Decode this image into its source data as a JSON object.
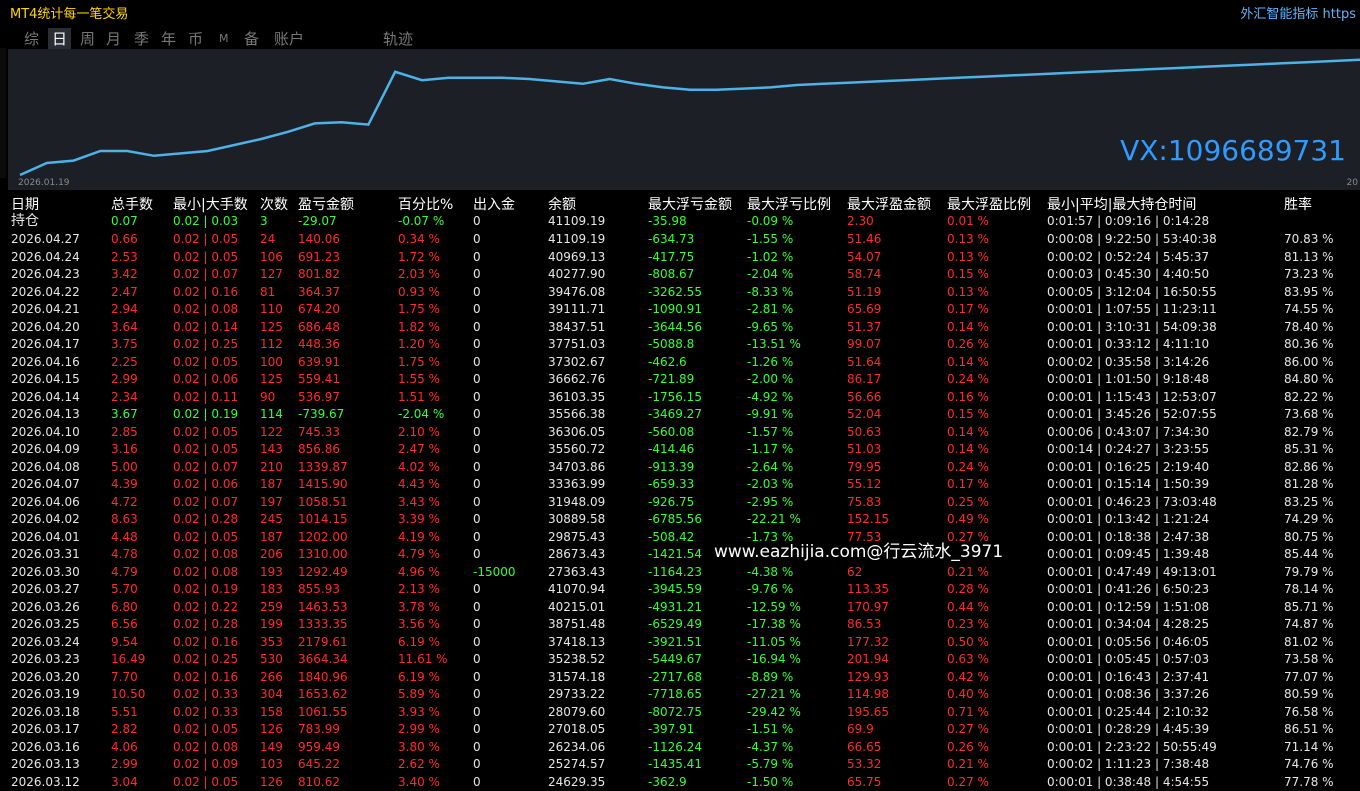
{
  "window": {
    "title": "MT4统计每一笔交易",
    "brand": "外汇智能指标 https"
  },
  "tabs": [
    {
      "label": "综",
      "active": false
    },
    {
      "label": "日",
      "active": true
    },
    {
      "label": "周",
      "active": false
    },
    {
      "label": "月",
      "active": false
    },
    {
      "label": "季",
      "active": false
    },
    {
      "label": "年",
      "active": false
    },
    {
      "label": "币",
      "active": false
    },
    {
      "label": "M",
      "active": false
    },
    {
      "label": "备",
      "active": false
    },
    {
      "label": "账户",
      "active": false
    },
    {
      "label": "轨迹",
      "active": false
    }
  ],
  "chart_data": {
    "type": "line",
    "x_start_label": "2026.01.19",
    "x_end_label": "20",
    "values": [
      0,
      0.1,
      0.12,
      0.2,
      0.2,
      0.16,
      0.18,
      0.2,
      0.25,
      0.3,
      0.36,
      0.43,
      0.44,
      0.42,
      0.86,
      0.79,
      0.81,
      0.81,
      0.81,
      0.8,
      0.78,
      0.76,
      0.8,
      0.76,
      0.73,
      0.71,
      0.71,
      0.72,
      0.73,
      0.75,
      0.76,
      0.77,
      0.78,
      0.79,
      0.8,
      0.81,
      0.82,
      0.83,
      0.84,
      0.85,
      0.86,
      0.87,
      0.88,
      0.89,
      0.9,
      0.91,
      0.92,
      0.93,
      0.94,
      0.95,
      0.96
    ],
    "color": "#4cb2e8"
  },
  "overlay": {
    "vx": "VX:1096689731",
    "watermark": "www.eazhijia.com@行云流水_3971"
  },
  "table": {
    "headers": [
      "日期",
      "总手数",
      "最小|大手数",
      "次数",
      "盈亏金额",
      "百分比%",
      "出入金",
      "余额",
      "最大浮亏金额",
      "最大浮亏比例",
      "最大浮盈金额",
      "最大浮盈比例",
      "最小|平均|最大持仓时间",
      "胜率"
    ],
    "holding": {
      "label": "持仓",
      "lots": "0.07",
      "minmax": "0.02 | 0.03",
      "count": "3",
      "pnl": "-29.07",
      "pct": "-0.07 %",
      "io": "0",
      "balance": "41109.19",
      "max_loss": "-35.98",
      "max_loss_pct": "-0.09 %",
      "max_profit": "2.30",
      "max_profit_pct": "0.01 %",
      "time": "0:01:57 | 0:09:16 | 0:14:28",
      "winrate": ""
    },
    "rows": [
      {
        "date": "2026.04.27",
        "lots": "0.66",
        "minmax": "0.02 | 0.05",
        "count": "24",
        "pnl": "140.06",
        "pct": "0.34 %",
        "io": "0",
        "balance": "41109.19",
        "max_loss": "-634.73",
        "max_loss_pct": "-1.55 %",
        "max_profit": "51.46",
        "max_profit_pct": "0.13 %",
        "time": "0:00:08 | 9:22:50 | 53:40:38",
        "winrate": "70.83 %",
        "pos": true
      },
      {
        "date": "2026.04.24",
        "lots": "2.53",
        "minmax": "0.02 | 0.05",
        "count": "106",
        "pnl": "691.23",
        "pct": "1.72 %",
        "io": "0",
        "balance": "40969.13",
        "max_loss": "-417.75",
        "max_loss_pct": "-1.02 %",
        "max_profit": "54.07",
        "max_profit_pct": "0.13 %",
        "time": "0:00:02 | 0:52:24 | 5:45:37",
        "winrate": "81.13 %",
        "pos": true
      },
      {
        "date": "2026.04.23",
        "lots": "3.42",
        "minmax": "0.02 | 0.07",
        "count": "127",
        "pnl": "801.82",
        "pct": "2.03 %",
        "io": "0",
        "balance": "40277.90",
        "max_loss": "-808.67",
        "max_loss_pct": "-2.04 %",
        "max_profit": "58.74",
        "max_profit_pct": "0.15 %",
        "time": "0:00:03 | 0:45:30 | 4:40:50",
        "winrate": "73.23 %",
        "pos": true
      },
      {
        "date": "2026.04.22",
        "lots": "2.47",
        "minmax": "0.02 | 0.16",
        "count": "81",
        "pnl": "364.37",
        "pct": "0.93 %",
        "io": "0",
        "balance": "39476.08",
        "max_loss": "-3262.55",
        "max_loss_pct": "-8.33 %",
        "max_profit": "51.19",
        "max_profit_pct": "0.13 %",
        "time": "0:00:05 | 3:12:04 | 16:50:55",
        "winrate": "83.95 %",
        "pos": true
      },
      {
        "date": "2026.04.21",
        "lots": "2.94",
        "minmax": "0.02 | 0.08",
        "count": "110",
        "pnl": "674.20",
        "pct": "1.75 %",
        "io": "0",
        "balance": "39111.71",
        "max_loss": "-1090.91",
        "max_loss_pct": "-2.81 %",
        "max_profit": "65.69",
        "max_profit_pct": "0.17 %",
        "time": "0:00:01 | 1:07:55 | 11:23:11",
        "winrate": "74.55 %",
        "pos": true
      },
      {
        "date": "2026.04.20",
        "lots": "3.64",
        "minmax": "0.02 | 0.14",
        "count": "125",
        "pnl": "686.48",
        "pct": "1.82 %",
        "io": "0",
        "balance": "38437.51",
        "max_loss": "-3644.56",
        "max_loss_pct": "-9.65 %",
        "max_profit": "51.37",
        "max_profit_pct": "0.14 %",
        "time": "0:00:01 | 3:10:31 | 54:09:38",
        "winrate": "78.40 %",
        "pos": true
      },
      {
        "date": "2026.04.17",
        "lots": "3.75",
        "minmax": "0.02 | 0.25",
        "count": "112",
        "pnl": "448.36",
        "pct": "1.20 %",
        "io": "0",
        "balance": "37751.03",
        "max_loss": "-5088.8",
        "max_loss_pct": "-13.51 %",
        "max_profit": "99.07",
        "max_profit_pct": "0.26 %",
        "time": "0:00:01 | 0:33:12 | 4:11:10",
        "winrate": "80.36 %",
        "pos": true
      },
      {
        "date": "2026.04.16",
        "lots": "2.25",
        "minmax": "0.02 | 0.05",
        "count": "100",
        "pnl": "639.91",
        "pct": "1.75 %",
        "io": "0",
        "balance": "37302.67",
        "max_loss": "-462.6",
        "max_loss_pct": "-1.26 %",
        "max_profit": "51.64",
        "max_profit_pct": "0.14 %",
        "time": "0:00:02 | 0:35:58 | 3:14:26",
        "winrate": "86.00 %",
        "pos": true
      },
      {
        "date": "2026.04.15",
        "lots": "2.99",
        "minmax": "0.02 | 0.06",
        "count": "125",
        "pnl": "559.41",
        "pct": "1.55 %",
        "io": "0",
        "balance": "36662.76",
        "max_loss": "-721.89",
        "max_loss_pct": "-2.00 %",
        "max_profit": "86.17",
        "max_profit_pct": "0.24 %",
        "time": "0:00:01 | 1:01:50 | 9:18:48",
        "winrate": "84.80 %",
        "pos": true
      },
      {
        "date": "2026.04.14",
        "lots": "2.34",
        "minmax": "0.02 | 0.11",
        "count": "90",
        "pnl": "536.97",
        "pct": "1.51 %",
        "io": "0",
        "balance": "36103.35",
        "max_loss": "-1756.15",
        "max_loss_pct": "-4.92 %",
        "max_profit": "56.66",
        "max_profit_pct": "0.16 %",
        "time": "0:00:01 | 1:15:43 | 12:53:07",
        "winrate": "82.22 %",
        "pos": true
      },
      {
        "date": "2026.04.13",
        "lots": "3.67",
        "minmax": "0.02 | 0.19",
        "count": "114",
        "pnl": "-739.67",
        "pct": "-2.04 %",
        "io": "0",
        "balance": "35566.38",
        "max_loss": "-3469.27",
        "max_loss_pct": "-9.91 %",
        "max_profit": "52.04",
        "max_profit_pct": "0.15 %",
        "time": "0:00:01 | 3:45:26 | 52:07:55",
        "winrate": "73.68 %",
        "pos": false
      },
      {
        "date": "2026.04.10",
        "lots": "2.85",
        "minmax": "0.02 | 0.05",
        "count": "122",
        "pnl": "745.33",
        "pct": "2.10 %",
        "io": "0",
        "balance": "36306.05",
        "max_loss": "-560.08",
        "max_loss_pct": "-1.57 %",
        "max_profit": "50.63",
        "max_profit_pct": "0.14 %",
        "time": "0:00:06 | 0:43:07 | 7:34:30",
        "winrate": "82.79 %",
        "pos": true
      },
      {
        "date": "2026.04.09",
        "lots": "3.16",
        "minmax": "0.02 | 0.05",
        "count": "143",
        "pnl": "856.86",
        "pct": "2.47 %",
        "io": "0",
        "balance": "35560.72",
        "max_loss": "-414.46",
        "max_loss_pct": "-1.17 %",
        "max_profit": "51.03",
        "max_profit_pct": "0.14 %",
        "time": "0:00:14 | 0:24:27 | 3:23:55",
        "winrate": "85.31 %",
        "pos": true
      },
      {
        "date": "2026.04.08",
        "lots": "5.00",
        "minmax": "0.02 | 0.07",
        "count": "210",
        "pnl": "1339.87",
        "pct": "4.02 %",
        "io": "0",
        "balance": "34703.86",
        "max_loss": "-913.39",
        "max_loss_pct": "-2.64 %",
        "max_profit": "79.95",
        "max_profit_pct": "0.24 %",
        "time": "0:00:01 | 0:16:25 | 2:19:40",
        "winrate": "82.86 %",
        "pos": true
      },
      {
        "date": "2026.04.07",
        "lots": "4.39",
        "minmax": "0.02 | 0.06",
        "count": "187",
        "pnl": "1415.90",
        "pct": "4.43 %",
        "io": "0",
        "balance": "33363.99",
        "max_loss": "-659.33",
        "max_loss_pct": "-2.03 %",
        "max_profit": "55.12",
        "max_profit_pct": "0.17 %",
        "time": "0:00:01 | 0:15:14 | 1:50:39",
        "winrate": "81.28 %",
        "pos": true
      },
      {
        "date": "2026.04.06",
        "lots": "4.72",
        "minmax": "0.02 | 0.07",
        "count": "197",
        "pnl": "1058.51",
        "pct": "3.43 %",
        "io": "0",
        "balance": "31948.09",
        "max_loss": "-926.75",
        "max_loss_pct": "-2.95 %",
        "max_profit": "75.83",
        "max_profit_pct": "0.25 %",
        "time": "0:00:01 | 0:46:23 | 73:03:48",
        "winrate": "83.25 %",
        "pos": true
      },
      {
        "date": "2026.04.02",
        "lots": "8.63",
        "minmax": "0.02 | 0.28",
        "count": "245",
        "pnl": "1014.15",
        "pct": "3.39 %",
        "io": "0",
        "balance": "30889.58",
        "max_loss": "-6785.56",
        "max_loss_pct": "-22.21 %",
        "max_profit": "152.15",
        "max_profit_pct": "0.49 %",
        "time": "0:00:01 | 0:13:42 | 1:21:24",
        "winrate": "74.29 %",
        "pos": true
      },
      {
        "date": "2026.04.01",
        "lots": "4.48",
        "minmax": "0.02 | 0.05",
        "count": "187",
        "pnl": "1202.00",
        "pct": "4.19 %",
        "io": "0",
        "balance": "29875.43",
        "max_loss": "-508.42",
        "max_loss_pct": "-1.73 %",
        "max_profit": "77.53",
        "max_profit_pct": "0.27 %",
        "time": "0:00:01 | 0:18:38 | 2:47:38",
        "winrate": "80.75 %",
        "pos": true
      },
      {
        "date": "2026.03.31",
        "lots": "4.78",
        "minmax": "0.02 | 0.08",
        "count": "206",
        "pnl": "1310.00",
        "pct": "4.79 %",
        "io": "0",
        "balance": "28673.43",
        "max_loss": "-1421.54",
        "max_loss_pct": "",
        "max_profit": "",
        "max_profit_pct": "",
        "time": "0:00:01 | 0:09:45 | 1:39:48",
        "winrate": "85.44 %",
        "pos": true
      },
      {
        "date": "2026.03.30",
        "lots": "4.79",
        "minmax": "0.02 | 0.08",
        "count": "193",
        "pnl": "1292.49",
        "pct": "4.96 %",
        "io": "-15000",
        "balance": "27363.43",
        "max_loss": "-1164.23",
        "max_loss_pct": "-4.38 %",
        "max_profit": "62",
        "max_profit_pct": "0.21 %",
        "time": "0:00:01 | 0:47:49 | 49:13:01",
        "winrate": "79.79 %",
        "pos": true
      },
      {
        "date": "2026.03.27",
        "lots": "5.70",
        "minmax": "0.02 | 0.19",
        "count": "183",
        "pnl": "855.93",
        "pct": "2.13 %",
        "io": "0",
        "balance": "41070.94",
        "max_loss": "-3945.59",
        "max_loss_pct": "-9.76 %",
        "max_profit": "113.35",
        "max_profit_pct": "0.28 %",
        "time": "0:00:01 | 0:41:26 | 6:50:23",
        "winrate": "78.14 %",
        "pos": true
      },
      {
        "date": "2026.03.26",
        "lots": "6.80",
        "minmax": "0.02 | 0.22",
        "count": "259",
        "pnl": "1463.53",
        "pct": "3.78 %",
        "io": "0",
        "balance": "40215.01",
        "max_loss": "-4931.21",
        "max_loss_pct": "-12.59 %",
        "max_profit": "170.97",
        "max_profit_pct": "0.44 %",
        "time": "0:00:01 | 0:12:59 | 1:51:08",
        "winrate": "85.71 %",
        "pos": true
      },
      {
        "date": "2026.03.25",
        "lots": "6.56",
        "minmax": "0.02 | 0.28",
        "count": "199",
        "pnl": "1333.35",
        "pct": "3.56 %",
        "io": "0",
        "balance": "38751.48",
        "max_loss": "-6529.49",
        "max_loss_pct": "-17.38 %",
        "max_profit": "86.53",
        "max_profit_pct": "0.23 %",
        "time": "0:00:01 | 0:34:04 | 4:28:25",
        "winrate": "74.87 %",
        "pos": true
      },
      {
        "date": "2026.03.24",
        "lots": "9.54",
        "minmax": "0.02 | 0.16",
        "count": "353",
        "pnl": "2179.61",
        "pct": "6.19 %",
        "io": "0",
        "balance": "37418.13",
        "max_loss": "-3921.51",
        "max_loss_pct": "-11.05 %",
        "max_profit": "177.32",
        "max_profit_pct": "0.50 %",
        "time": "0:00:01 | 0:05:56 | 0:46:05",
        "winrate": "81.02 %",
        "pos": true
      },
      {
        "date": "2026.03.23",
        "lots": "16.49",
        "minmax": "0.02 | 0.25",
        "count": "530",
        "pnl": "3664.34",
        "pct": "11.61 %",
        "io": "0",
        "balance": "35238.52",
        "max_loss": "-5449.67",
        "max_loss_pct": "-16.94 %",
        "max_profit": "201.94",
        "max_profit_pct": "0.63 %",
        "time": "0:00:01 | 0:05:45 | 0:57:03",
        "winrate": "73.58 %",
        "pos": true
      },
      {
        "date": "2026.03.20",
        "lots": "7.70",
        "minmax": "0.02 | 0.16",
        "count": "266",
        "pnl": "1840.96",
        "pct": "6.19 %",
        "io": "0",
        "balance": "31574.18",
        "max_loss": "-2717.68",
        "max_loss_pct": "-8.89 %",
        "max_profit": "129.93",
        "max_profit_pct": "0.42 %",
        "time": "0:00:01 | 0:16:43 | 2:37:41",
        "winrate": "77.07 %",
        "pos": true
      },
      {
        "date": "2026.03.19",
        "lots": "10.50",
        "minmax": "0.02 | 0.33",
        "count": "304",
        "pnl": "1653.62",
        "pct": "5.89 %",
        "io": "0",
        "balance": "29733.22",
        "max_loss": "-7718.65",
        "max_loss_pct": "-27.21 %",
        "max_profit": "114.98",
        "max_profit_pct": "0.40 %",
        "time": "0:00:01 | 0:08:36 | 3:37:26",
        "winrate": "80.59 %",
        "pos": true
      },
      {
        "date": "2026.03.18",
        "lots": "5.51",
        "minmax": "0.02 | 0.33",
        "count": "158",
        "pnl": "1061.55",
        "pct": "3.93 %",
        "io": "0",
        "balance": "28079.60",
        "max_loss": "-8072.75",
        "max_loss_pct": "-29.42 %",
        "max_profit": "195.65",
        "max_profit_pct": "0.71 %",
        "time": "0:00:01 | 0:25:44 | 2:10:32",
        "winrate": "76.58 %",
        "pos": true
      },
      {
        "date": "2026.03.17",
        "lots": "2.82",
        "minmax": "0.02 | 0.05",
        "count": "126",
        "pnl": "783.99",
        "pct": "2.99 %",
        "io": "0",
        "balance": "27018.05",
        "max_loss": "-397.91",
        "max_loss_pct": "-1.51 %",
        "max_profit": "69.9",
        "max_profit_pct": "0.27 %",
        "time": "0:00:01 | 0:28:29 | 4:45:39",
        "winrate": "86.51 %",
        "pos": true
      },
      {
        "date": "2026.03.16",
        "lots": "4.06",
        "minmax": "0.02 | 0.08",
        "count": "149",
        "pnl": "959.49",
        "pct": "3.80 %",
        "io": "0",
        "balance": "26234.06",
        "max_loss": "-1126.24",
        "max_loss_pct": "-4.37 %",
        "max_profit": "66.65",
        "max_profit_pct": "0.26 %",
        "time": "0:00:01 | 2:23:22 | 50:55:49",
        "winrate": "71.14 %",
        "pos": true
      },
      {
        "date": "2026.03.13",
        "lots": "2.99",
        "minmax": "0.02 | 0.09",
        "count": "103",
        "pnl": "645.22",
        "pct": "2.62 %",
        "io": "0",
        "balance": "25274.57",
        "max_loss": "-1435.41",
        "max_loss_pct": "-5.79 %",
        "max_profit": "53.32",
        "max_profit_pct": "0.21 %",
        "time": "0:00:02 | 1:11:23 | 7:38:48",
        "winrate": "74.76 %",
        "pos": true
      },
      {
        "date": "2026.03.12",
        "lots": "3.04",
        "minmax": "0.02 | 0.05",
        "count": "126",
        "pnl": "810.62",
        "pct": "3.40 %",
        "io": "0",
        "balance": "24629.35",
        "max_loss": "-362.9",
        "max_loss_pct": "-1.50 %",
        "max_profit": "65.75",
        "max_profit_pct": "0.27 %",
        "time": "0:00:01 | 0:38:48 | 4:54:55",
        "winrate": "77.78 %",
        "pos": true
      }
    ]
  }
}
